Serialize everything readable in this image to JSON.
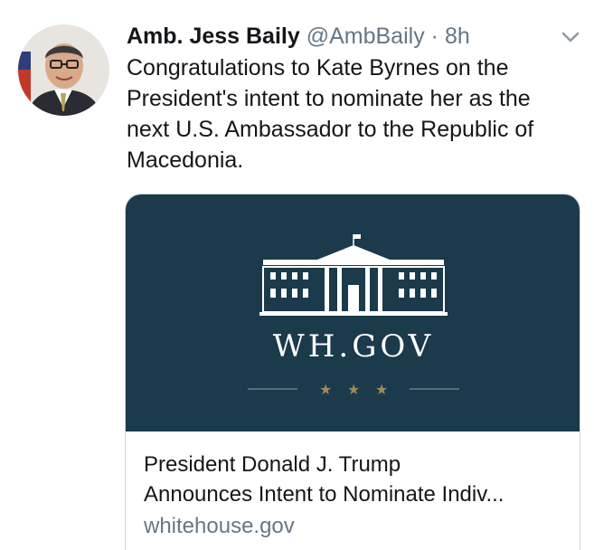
{
  "tweet": {
    "author_name": "Amb. Jess Baily",
    "handle": "@AmbBaily",
    "separator": "·",
    "time": "8h",
    "text_lines": [
      "Congratulations to Kate Byrnes on the",
      "President's intent to nominate her as the",
      "next U.S. Ambassador to the Republic of",
      "Macedonia."
    ]
  },
  "card": {
    "image_logo_text": "WH.GOV",
    "title_line1": "President Donald J. Trump",
    "title_line2": "Announces Intent to Nominate Indiv...",
    "domain": "whitehouse.gov"
  },
  "icons": {
    "menu": "chevron-down-icon",
    "avatar": "avatar",
    "logo": "white-house-icon"
  },
  "colors": {
    "card_background": "#1b3a4b",
    "secondary_text": "#657786",
    "primary_text": "#14171a",
    "ornament_gold": "#a08a5a"
  }
}
